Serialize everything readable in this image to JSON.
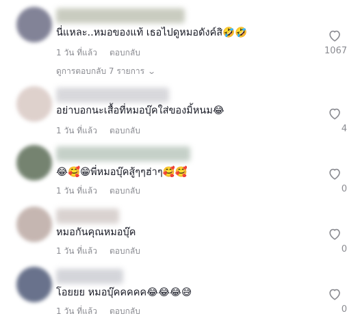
{
  "comments": [
    {
      "text": "นี่แหละ..หมอของแท้ เธอไปดูหมอดังค์สิ🤣🤣",
      "time": "1 วัน ที่แล้ว",
      "reply": "ตอบกลับ",
      "likes": "1067",
      "avatar_color": "#6d6e86",
      "name_color": "#c9ccc0"
    },
    {
      "text": "อย่าบอกนะเสื้อที่หมอบุ๊คใส่ของมิ้หนม😂",
      "time": "1 วัน ที่แล้ว",
      "reply": "ตอบกลับ",
      "likes": "4",
      "avatar_color": "#d9c9c4",
      "name_color": "#d8d8dc"
    },
    {
      "text": "😂🥰😁พี่หมอบุ๊คสู้ๆๆฮ่าๆ🥰🥰",
      "time": "1 วัน ที่แล้ว",
      "reply": "ตอบกลับ",
      "likes": "0",
      "avatar_color": "#5d6e58",
      "name_color": "#c5d0c8"
    },
    {
      "text": "หมอกันคุณหมอบุ๊ค",
      "time": "1 วัน ที่แล้ว",
      "reply": "ตอบกลับ",
      "likes": "0",
      "avatar_color": "#bcaaa4",
      "name_color": "#d9d2d0"
    },
    {
      "text": "โอยยย หมอบุ๊คคคคค😂😂😂😅",
      "time": "1 วัน ที่แล้ว",
      "reply": "ตอบกลับ",
      "likes": "0",
      "avatar_color": "#4f5a78",
      "name_color": "#d4d5da"
    }
  ],
  "view_replies": "ดูการตอบกลับ 7 รายการ",
  "icons": {
    "like": "heart-outline-icon",
    "expand": "chevron-down-icon"
  }
}
